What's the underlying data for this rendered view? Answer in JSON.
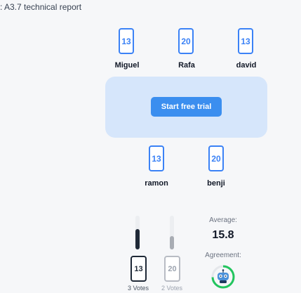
{
  "header": {
    "breadcrumb": ": A3.7 technical report"
  },
  "players_top": [
    {
      "name": "Miguel",
      "card": "13"
    },
    {
      "name": "Rafa",
      "card": "20"
    },
    {
      "name": "david",
      "card": "13"
    }
  ],
  "players_bottom": [
    {
      "name": "ramon",
      "card": "13"
    },
    {
      "name": "benji",
      "card": "20"
    }
  ],
  "table": {
    "cta_label": "Start free trial"
  },
  "results": {
    "votes": [
      {
        "card": "13",
        "count_label": "3 Votes",
        "share": 0.6
      },
      {
        "card": "20",
        "count_label": "2 Votes",
        "share": 0.4
      }
    ],
    "average_label": "Average:",
    "average_value": "15.8",
    "agreement_label": "Agreement:",
    "agreement_icon": "robot-icon"
  },
  "colors": {
    "accent": "#3b82f6",
    "table": "#d6e6fb",
    "agreement": "#22c55e"
  }
}
